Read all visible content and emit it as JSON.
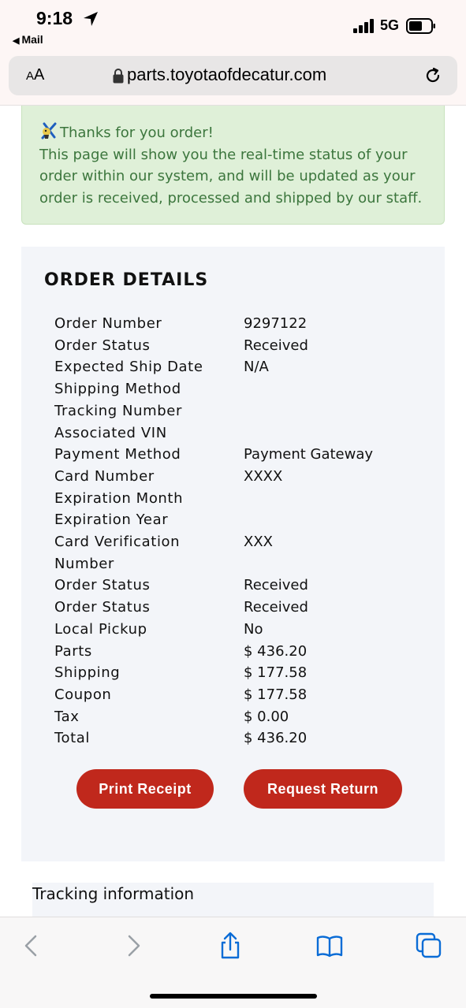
{
  "status_bar": {
    "time": "9:18",
    "back_label": "Mail",
    "network": "5G"
  },
  "browser": {
    "aa_label_big": "A",
    "aa_label_small": "A",
    "aa_label": "AA",
    "url": "parts.toyotaofdecatur.com"
  },
  "alert": {
    "lines": [
      "Thanks for you order!",
      "This page will show you the real-time status of your",
      "order within our system, and will be updated as your",
      "order is received, processed and shipped by our staff."
    ]
  },
  "order": {
    "title": "ORDER DETAILS",
    "rows": [
      {
        "label": "Order Number",
        "value": "9297122"
      },
      {
        "label": "Order Status",
        "value": "Received"
      },
      {
        "label": "Expected Ship Date",
        "value": "N/A"
      },
      {
        "label": "Shipping Method",
        "value": ""
      },
      {
        "label": "Tracking Number",
        "value": ""
      },
      {
        "label": "Associated VIN",
        "value": ""
      },
      {
        "label": "Payment Method",
        "value": "Payment Gateway"
      },
      {
        "label": "Card Number",
        "value": "XXXX"
      },
      {
        "label": "Expiration Month",
        "value": ""
      },
      {
        "label": "Expiration Year",
        "value": ""
      },
      {
        "label": "Card Verification",
        "value": "XXX"
      },
      {
        "label": "Number",
        "value": ""
      },
      {
        "label": "Order Status",
        "value": "Received"
      },
      {
        "label": "Order Status",
        "value": "Received"
      },
      {
        "label": "Local Pickup",
        "value": "No"
      },
      {
        "label": "Parts",
        "value": "$ 436.20"
      },
      {
        "label": "Shipping",
        "value": "$ 177.58"
      },
      {
        "label": "Coupon",
        "value": "$ 177.58"
      },
      {
        "label": "Tax",
        "value": "$ 0.00"
      },
      {
        "label": "Total",
        "value": "$ 436.20"
      }
    ],
    "print_label": "Print Receipt",
    "return_label": "Request Return"
  },
  "tracking": {
    "title": "Tracking information"
  },
  "colors": {
    "accent": "#c0281c",
    "alert_bg": "#dff0d8",
    "alert_text": "#3c763d",
    "ios_blue": "#0a6cd6"
  },
  "icons": {
    "toolbar": [
      "back-chevron-icon",
      "forward-chevron-icon",
      "share-icon",
      "bookmarks-icon",
      "tabs-icon"
    ]
  }
}
